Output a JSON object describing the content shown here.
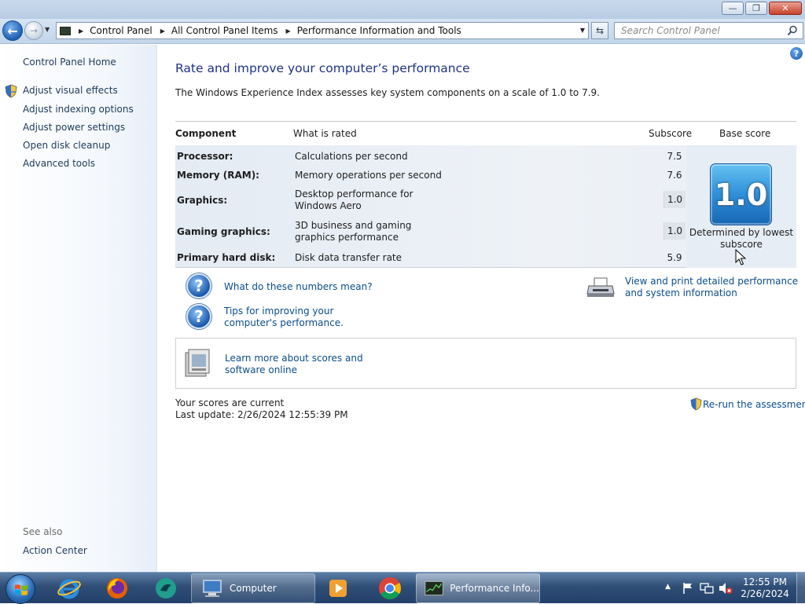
{
  "window": {
    "minimize": "—",
    "maximize": "❐",
    "close": "✕"
  },
  "navigation": {
    "breadcrumbs": [
      "Control Panel",
      "All Control Panel Items",
      "Performance Information and Tools"
    ],
    "search_placeholder": "Search Control Panel"
  },
  "sidebar": {
    "home": "Control Panel Home",
    "items": [
      {
        "label": "Adjust visual effects",
        "icon": "uac-shield-icon"
      },
      {
        "label": "Adjust indexing options"
      },
      {
        "label": "Adjust power settings"
      },
      {
        "label": "Open disk cleanup"
      },
      {
        "label": "Advanced tools"
      }
    ],
    "see_also_heading": "See also",
    "see_also_items": [
      "Action Center"
    ]
  },
  "main": {
    "title": "Rate and improve your computer’s performance",
    "description": "The Windows Experience Index assesses key system components on a scale of 1.0 to 7.9.",
    "table": {
      "headers": {
        "component": "Component",
        "what": "What is rated",
        "subscore": "Subscore",
        "base": "Base score"
      },
      "rows": [
        {
          "component": "Processor:",
          "what": "Calculations per second",
          "subscore": "7.5"
        },
        {
          "component": "Memory (RAM):",
          "what": "Memory operations per second",
          "subscore": "7.6"
        },
        {
          "component": "Graphics:",
          "what": "Desktop performance for Windows Aero",
          "subscore": "1.0"
        },
        {
          "component": "Gaming graphics:",
          "what": "3D business and gaming graphics performance",
          "subscore": "1.0"
        },
        {
          "component": "Primary hard disk:",
          "what": "Disk data transfer rate",
          "subscore": "5.9"
        }
      ],
      "base_score": "1.0",
      "base_note": "Determined by lowest subscore"
    },
    "links": {
      "numbers": "What do these numbers mean?",
      "tips": "Tips for improving your computer's performance.",
      "print": "View and print detailed performance and system information",
      "learn": "Learn more about scores and software online"
    },
    "status": {
      "current": "Your scores are current",
      "last_update": "Last update: 2/26/2024 12:55:39 PM",
      "rerun": "Re-run the assessment"
    }
  },
  "taskbar": {
    "buttons": [
      {
        "label": "Computer"
      },
      {
        "label": "Performance Info..."
      }
    ],
    "clock_time": "12:55 PM",
    "clock_date": "2/26/2024"
  },
  "colors": {
    "link": "#0a4d8c",
    "title": "#1e3287",
    "score_tile": "#2f8fd7"
  }
}
